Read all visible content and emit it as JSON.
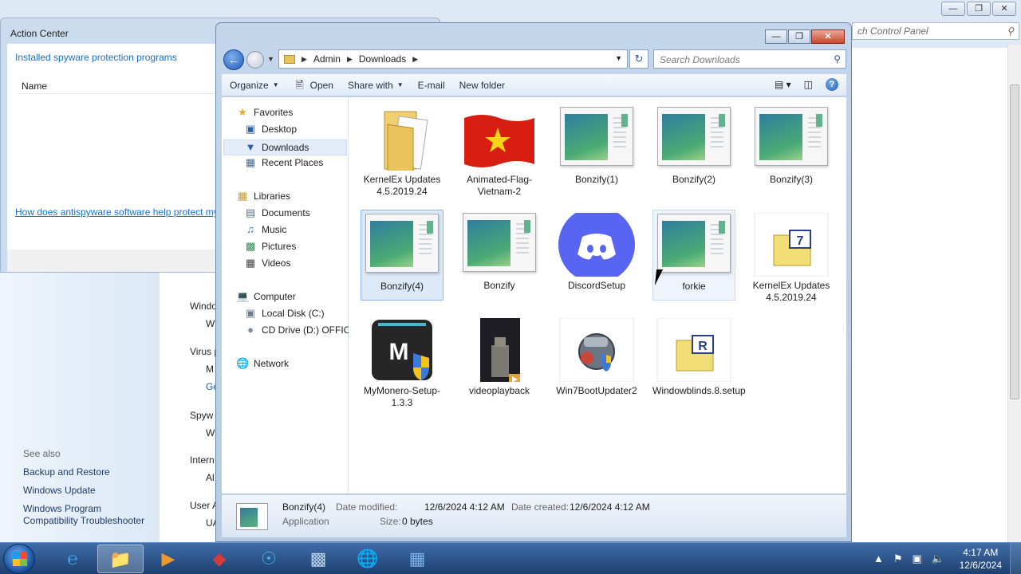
{
  "control_panel": {
    "search_placeholder": "ch Control Panel",
    "see_also": "See also",
    "links": [
      "Backup and Restore",
      "Windows Update",
      "Windows Program",
      "Compatibility Troubleshooter"
    ],
    "fragments": [
      "Windo",
      "W",
      "Virus p",
      "M",
      "Ge",
      "Spyw",
      "W",
      "Intern",
      "Al",
      "User A",
      "UA"
    ]
  },
  "action_center": {
    "title": "Action Center",
    "heading_link": "Installed spyware protection programs",
    "column_name": "Name",
    "help_link": "How does antispyware software help protect my"
  },
  "explorer": {
    "path": [
      "Admin",
      "Downloads"
    ],
    "search_placeholder": "Search Downloads",
    "toolbar": {
      "organize": "Organize",
      "open": "Open",
      "share_with": "Share with",
      "email": "E-mail",
      "new_folder": "New folder"
    },
    "nav": {
      "favorites": "Favorites",
      "desktop": "Desktop",
      "downloads": "Downloads",
      "recent": "Recent Places",
      "libraries": "Libraries",
      "documents": "Documents",
      "music": "Music",
      "pictures": "Pictures",
      "videos": "Videos",
      "computer": "Computer",
      "local_disk": "Local Disk (C:)",
      "cd_drive": "CD Drive (D:) OFFICE",
      "network": "Network"
    },
    "files": [
      {
        "name": "KernelEx Updates 4.5.2019.24"
      },
      {
        "name": "Animated-Flag-Vietnam-2"
      },
      {
        "name": "Bonzify(1)"
      },
      {
        "name": "Bonzify(2)"
      },
      {
        "name": "Bonzify(3)"
      },
      {
        "name": "Bonzify(4)"
      },
      {
        "name": "Bonzify"
      },
      {
        "name": "DiscordSetup"
      },
      {
        "name": "forkie"
      },
      {
        "name": "KernelEx Updates 4.5.2019.24"
      },
      {
        "name": "MyMonero-Setup-1.3.3"
      },
      {
        "name": "videoplayback"
      },
      {
        "name": "Win7BootUpdater2"
      },
      {
        "name": "Windowblinds.8.setup"
      }
    ],
    "status": {
      "name": "Bonzify(4)",
      "type": "Application",
      "modified_label": "Date modified:",
      "modified_value": "12/6/2024 4:12 AM",
      "created_label": "Date created:",
      "created_value": "12/6/2024 4:12 AM",
      "size_label": "Size:",
      "size_value": "0 bytes"
    }
  },
  "taskbar": {
    "time": "4:17 AM",
    "date": "12/6/2024"
  }
}
